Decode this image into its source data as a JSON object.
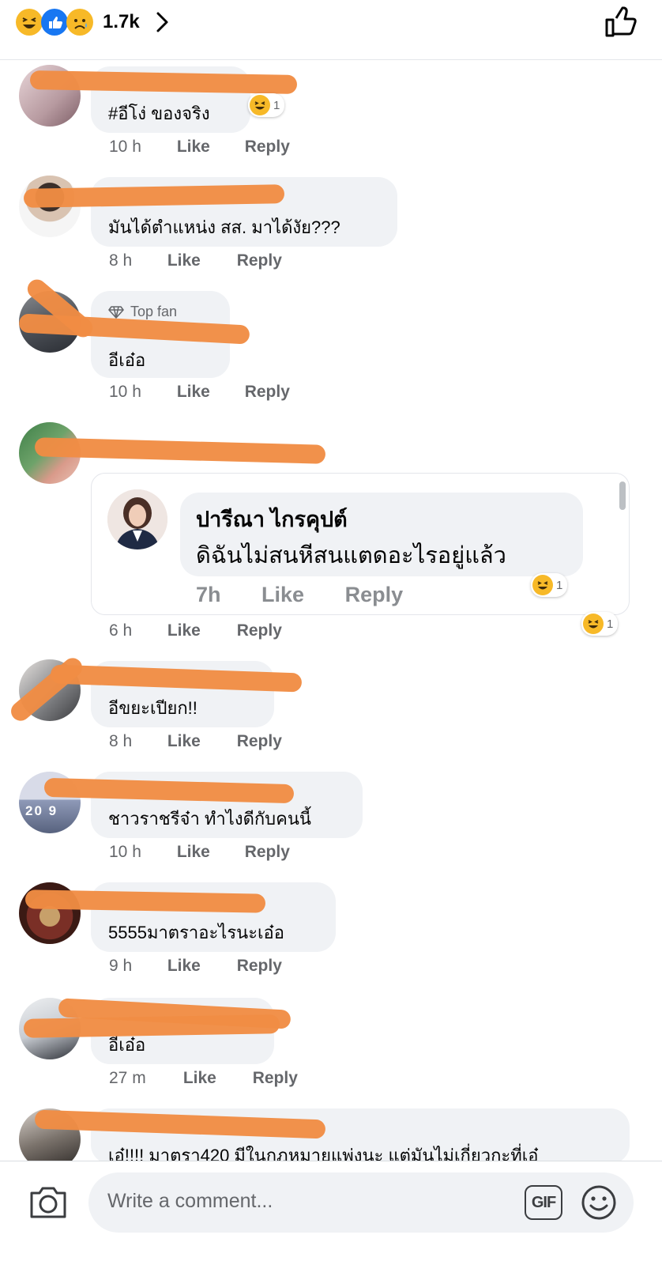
{
  "header": {
    "reaction_count": "1.7k",
    "icons": [
      "haha-reaction-icon",
      "like-reaction-icon",
      "sad-reaction-icon",
      "chevron-right-icon",
      "thumbs-up-icon"
    ]
  },
  "comments": [
    {
      "text": "#อีโง่ ของจริง",
      "time": "10 h",
      "like": "Like",
      "reply": "Reply",
      "reaction_count": "1"
    },
    {
      "text": "มันได้ตำแหน่ง สส. มาได้งัย???",
      "time": "8 h",
      "like": "Like",
      "reply": "Reply"
    },
    {
      "badge": "Top fan",
      "text": "อีเอ๋อ",
      "time": "10 h",
      "like": "Like",
      "reply": "Reply"
    },
    {
      "time": "6 h",
      "like": "Like",
      "reply": "Reply",
      "reaction_count": "1",
      "embedded": {
        "name": "ปารีณา ไกรคุปต์",
        "text": "ดิฉันไม่สนหีสนแตดอะไรอยู่แล้ว",
        "time": "7h",
        "like": "Like",
        "reply": "Reply",
        "reaction_count": "1"
      }
    },
    {
      "text": "อีขยะเปียก!!",
      "time": "8 h",
      "like": "Like",
      "reply": "Reply"
    },
    {
      "text": "ชาวราชรีจ๋า ทำไงดีกับคนนี้",
      "time": "10 h",
      "like": "Like",
      "reply": "Reply",
      "avatar_text": "20 9"
    },
    {
      "text": "5555มาตราอะไรนะเอ๋อ",
      "time": "9 h",
      "like": "Like",
      "reply": "Reply"
    },
    {
      "text": "อีเอ๋อ",
      "time": "27 m",
      "like": "Like",
      "reply": "Reply"
    },
    {
      "text": "เอ๋!!!! มาตรา420 มีในกฎหมายแพ่งนะ แต่มันไม่เกี่ยวกะที่เอ๋"
    }
  ],
  "composer": {
    "placeholder": "Write a comment...",
    "gif_label": "GIF",
    "icons": [
      "camera-icon",
      "gif-icon",
      "smiley-icon"
    ]
  },
  "colors": {
    "bubble": "#f0f2f5",
    "meta_text": "#65676b",
    "scribble": "#f08c44",
    "like_blue": "#1877f2",
    "emoji_yellow": "#f7b928"
  }
}
